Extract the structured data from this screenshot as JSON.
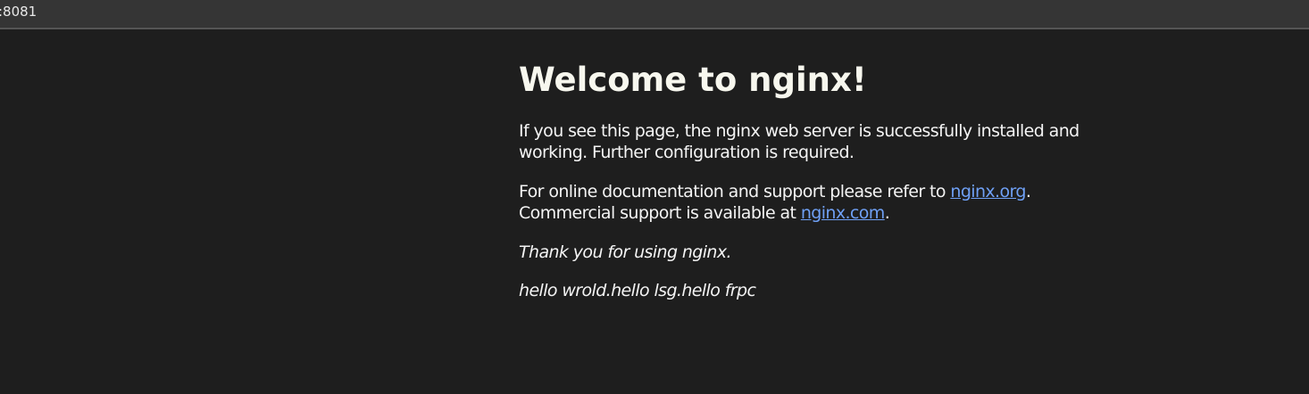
{
  "browser": {
    "address": ":8081"
  },
  "page": {
    "heading": "Welcome to nginx!",
    "para1": "If you see this page, the nginx web server is successfully installed and working. Further configuration is required.",
    "para2_before": "For online documentation and support please refer to ",
    "link_org": "nginx.org",
    "para2_mid": ".",
    "para2_line2": "Commercial support is available at ",
    "link_com": "nginx.com",
    "para2_end": ".",
    "thanks": "Thank you for using nginx.",
    "hello": "hello wrold.hello lsg.hello frpc"
  },
  "colors": {
    "background": "#1e1e1e",
    "text": "#f4f4f4",
    "link": "#6fa0f5",
    "address_bar": "#353535"
  }
}
